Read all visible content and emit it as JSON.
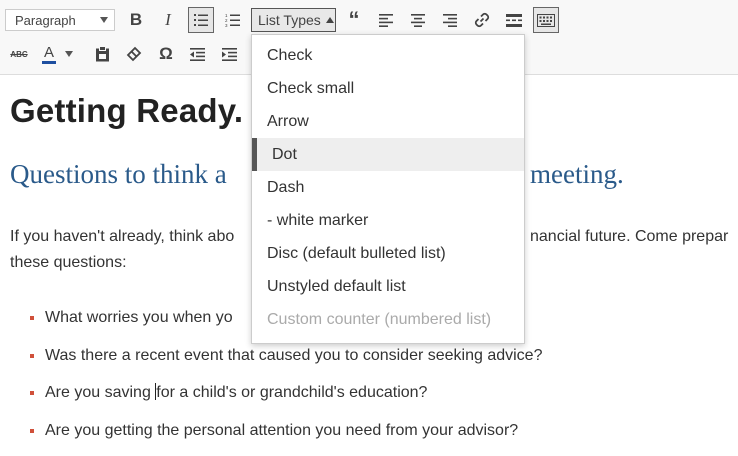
{
  "toolbar": {
    "format_select": "Paragraph",
    "list_types_label": "List Types",
    "row2_letters": {
      "strikethrough": "ABC",
      "text_color": "A"
    }
  },
  "editor": {
    "heading": "Getting Ready.",
    "subheading_left": "Questions to think a",
    "subheading_right": "meeting.",
    "paragraph_line1": "If you haven't already, think abo",
    "paragraph_line1_right": "nancial future. Come prepar",
    "paragraph_line2": "these questions:",
    "bullets": [
      "What worries you when yo",
      "Was there a recent event that caused you to consider seeking advice?",
      "Are you saving ",
      "Are you getting the personal attention you need from your advisor?"
    ],
    "bullet3_after_cursor": "for a child's or grandchild's education?",
    "accent_color": "#d0503a",
    "heading_color": "#2a5a8a"
  },
  "menu": {
    "items": [
      {
        "label": "Check",
        "state": "normal"
      },
      {
        "label": "Check small",
        "state": "normal"
      },
      {
        "label": "Arrow",
        "state": "normal"
      },
      {
        "label": "Dot",
        "state": "selected"
      },
      {
        "label": "Dash",
        "state": "normal"
      },
      {
        "label": "- white marker",
        "state": "normal"
      },
      {
        "label": "Disc (default bulleted list)",
        "state": "normal"
      },
      {
        "label": "Unstyled default list",
        "state": "normal"
      },
      {
        "label": "Custom counter (numbered list)",
        "state": "disabled"
      }
    ]
  }
}
